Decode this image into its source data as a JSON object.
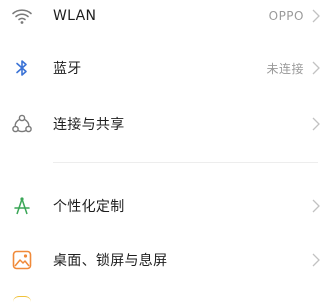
{
  "settings": {
    "wlan": {
      "label": "WLAN",
      "value": "OPPO",
      "icon": "wifi-icon"
    },
    "bluetooth": {
      "label": "蓝牙",
      "value": "未连接",
      "icon": "bluetooth-icon"
    },
    "connect_share": {
      "label": "连接与共享",
      "icon": "share-icon"
    },
    "personalization": {
      "label": "个性化定制",
      "icon": "brush-icon"
    },
    "desktop_lock": {
      "label": "桌面、锁屏与息屏",
      "icon": "wallpaper-icon"
    }
  },
  "colors": {
    "icon_gray": "#7a7a7a",
    "bluetooth_blue": "#3b73d6",
    "personalize_green": "#3aa657",
    "wallpaper_orange": "#f08a3a"
  }
}
